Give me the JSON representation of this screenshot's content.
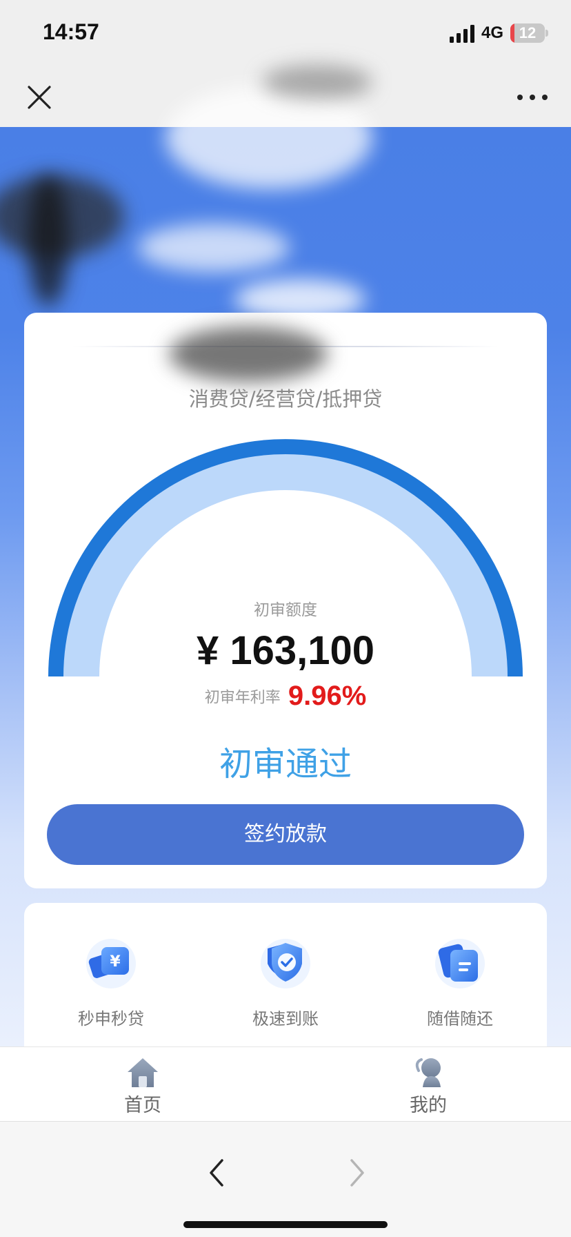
{
  "status_bar": {
    "time": "14:57",
    "network": "4G",
    "battery": "12",
    "battery_level_percent": 12
  },
  "nav": {
    "close_icon": "close-icon",
    "more_icon": "more-icon"
  },
  "loan_card": {
    "product_types": "消费贷/经营贷/抵押贷",
    "quota_label": "初审额度",
    "quota_amount": "¥ 163,100",
    "rate_label": "初审年利率",
    "rate_value": "9.96%",
    "status": "初审通过",
    "sign_button_label": "签约放款"
  },
  "features": [
    {
      "label": "秒申秒贷",
      "icon": "yen-card-icon"
    },
    {
      "label": "极速到账",
      "icon": "shield-check-icon"
    },
    {
      "label": "随借随还",
      "icon": "document-icon"
    }
  ],
  "tab_bar": {
    "tabs": [
      {
        "label": "首页",
        "icon": "home-icon"
      },
      {
        "label": "我的",
        "icon": "user-icon"
      }
    ]
  },
  "browser_bar": {
    "back_icon": "chevron-left-icon",
    "forward_icon": "chevron-right-icon"
  },
  "colors": {
    "brand_blue": "#4a74d2",
    "gauge_outer": "#1f78d8",
    "gauge_inner": "#bcd8fa",
    "rate_red": "#e21b1b",
    "status_blue": "#3fa1e6"
  }
}
